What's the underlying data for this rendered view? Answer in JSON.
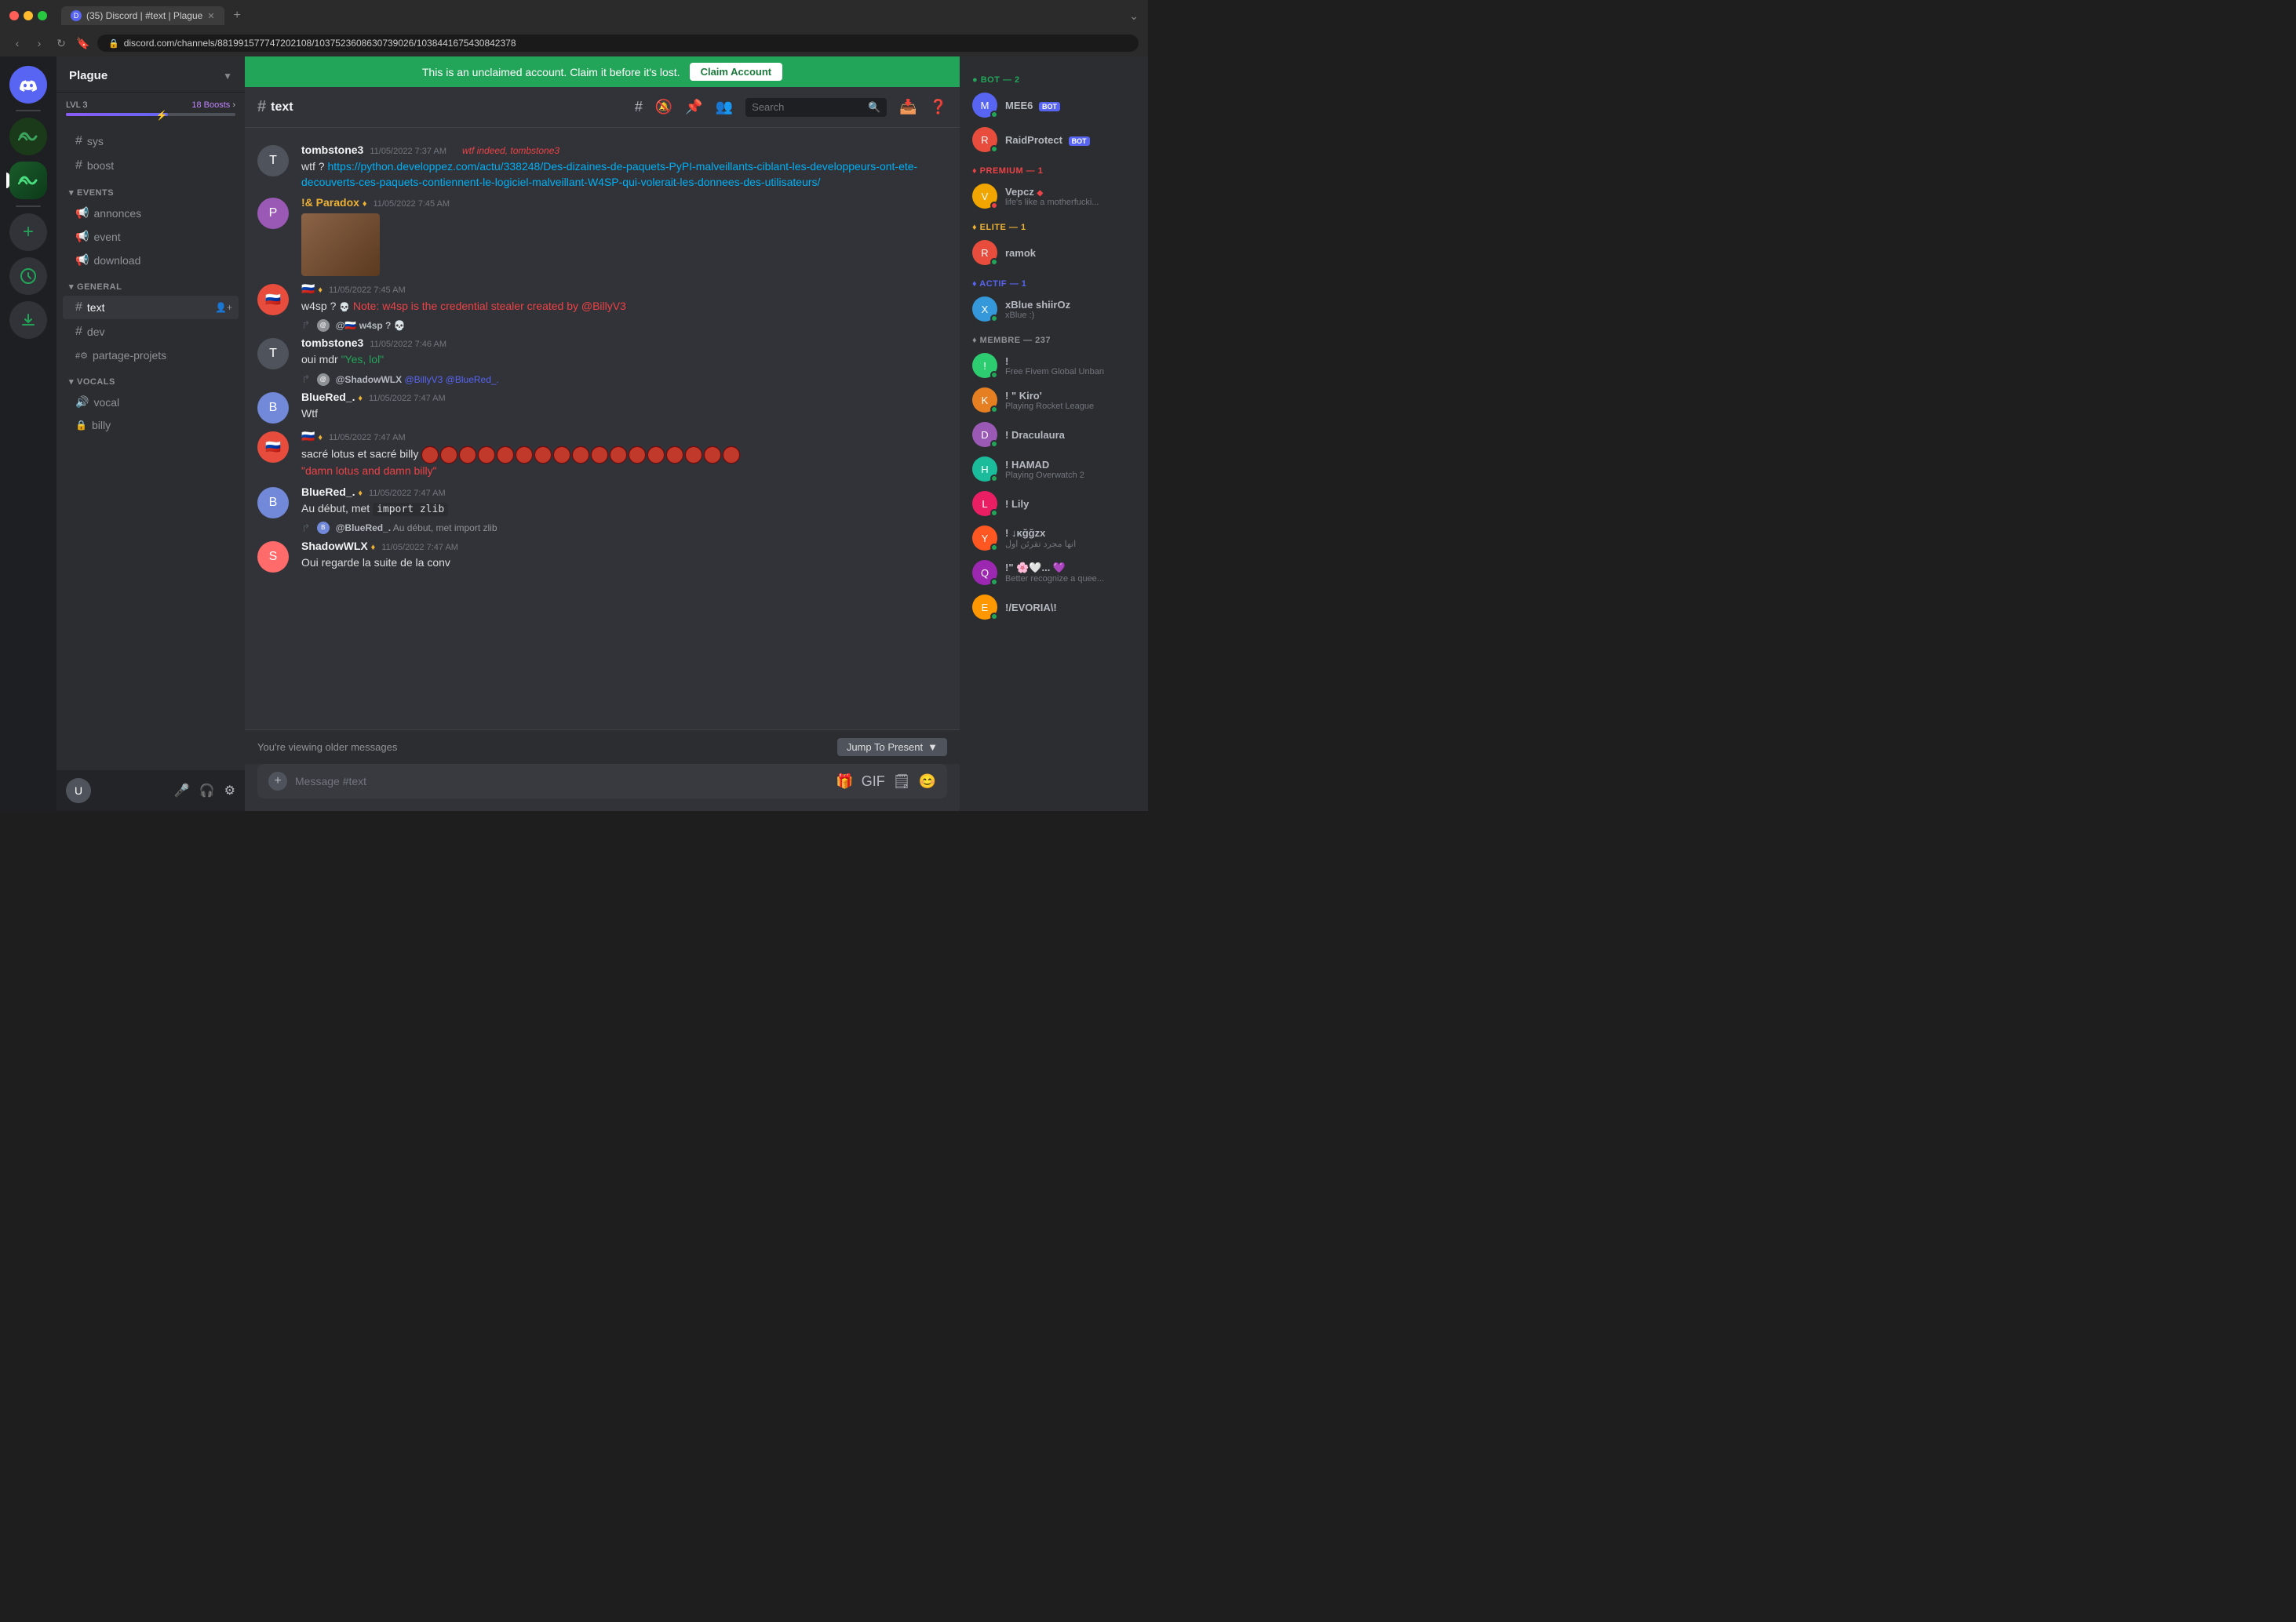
{
  "browser": {
    "tab_count": "35",
    "tab_title": "(35) Discord | #text | Plague",
    "url": "discord.com/channels/881991577747202108/1037523608630739026/1038441675430842378"
  },
  "notification": {
    "text": "This is an unclaimed account. Claim it before it's lost.",
    "button_label": "Claim Account"
  },
  "server": {
    "name": "Plague",
    "boost_level": "LVL 3",
    "boosts": "18 Boosts"
  },
  "channel": {
    "name": "text",
    "category_events": "EVENTS",
    "channel_annonces": "annonces",
    "channel_event": "event",
    "channel_download": "download",
    "category_general": "GENERAL",
    "channel_text": "text",
    "channel_dev": "dev",
    "channel_partage": "partage-projets",
    "category_vocals": "VOCALS",
    "channel_vocal": "vocal",
    "channel_billy": "billy",
    "channel_sys": "sys",
    "channel_boost": "boost"
  },
  "header": {
    "channel_name": "text",
    "search_placeholder": "Search"
  },
  "messages": [
    {
      "id": "msg1",
      "username": "tombstone3",
      "timestamp": "11/05/2022 7:37 AM",
      "color": "default",
      "bot_tag": "",
      "reply_to": null,
      "text": "wtf ?",
      "link": "https://python.developpez.com/actu/338248/Des-dizaines-de-paquets-PyPI-malveillants-ciblant-les-developpeurs-ont-ete-decouverts-ces-paquets-contiennent-le-logiciel-malveillant-W4SP-qui-volerait-les-donnees-des-utilisateurs/",
      "link_text": "https://python.developpez.com/actu/338248/Des-dizaines-de-paquets-PyPI-malveillants-ciblant-les-developpeurs-ont-ete-decouverts-ces-paquets-contiennent-le-logiciel-malveillant-W4SP-qui-volerait-les-donnees-des-utilisateurs/",
      "extra": "wtf indeed, tombstone3",
      "extra_color": "red",
      "has_image": false
    },
    {
      "id": "msg2",
      "username": "!& Paradox",
      "timestamp": "11/05/2022 7:45 AM",
      "color": "default",
      "bot_tag": "",
      "reply_to": null,
      "text": "",
      "has_image": true
    },
    {
      "id": "msg3",
      "username": "",
      "timestamp": "11/05/2022 7:45 AM",
      "color": "default",
      "bot_tag": "",
      "reply_to": null,
      "text": "w4sp ?",
      "note": "Note: w4sp is the credential stealer created by @BillyV3",
      "note_color": "red",
      "has_image": false
    },
    {
      "id": "msg4",
      "username": "tombstone3",
      "timestamp": "11/05/2022 7:46 AM",
      "color": "default",
      "reply_to": "@w4sp ?",
      "text": "oui mdr",
      "quoted": "\"Yes, lol\"",
      "quoted_color": "green",
      "has_image": false
    },
    {
      "id": "msg5",
      "username": "BlueRed_.",
      "timestamp": "11/05/2022 7:47 AM",
      "color": "default",
      "bot_tag": "",
      "reply_to": "@ShadowWLX @BillyV3 @BlueRed_.",
      "text": "Wtf",
      "has_image": false
    },
    {
      "id": "msg6",
      "username": "",
      "timestamp": "11/05/2022 7:47 AM",
      "color": "default",
      "reply_to": null,
      "text": "sacré lotus et sacré billy",
      "quoted": "\"damn lotus and damn billy\"",
      "quoted_color": "red",
      "has_emojis": true
    },
    {
      "id": "msg7",
      "username": "BlueRed_.",
      "timestamp": "11/05/2022 7:47 AM",
      "color": "default",
      "reply_to": null,
      "text": "Au début, met import zlib",
      "has_code": true,
      "code": "import zlib"
    },
    {
      "id": "msg8",
      "username": "ShadowWLX",
      "timestamp": "11/05/2022 7:47 AM",
      "color": "default",
      "reply_to": "@BlueRed_. Au début, met import zlib",
      "text": "Oui regarde la suite de la conv",
      "has_image": false
    }
  ],
  "input": {
    "placeholder": "Message #text"
  },
  "older_messages": {
    "text": "You're viewing older messages",
    "button_label": "Jump To Present"
  },
  "members": {
    "categories": [
      {
        "name": "BOT — 2",
        "color": "#23a559",
        "members": [
          {
            "name": "MEE6",
            "bot": true,
            "status": "online",
            "color": "mee6",
            "status_color": "online"
          },
          {
            "name": "RaidProtect",
            "bot": true,
            "status": "online",
            "color": "raidprotect",
            "status_color": "online"
          }
        ]
      },
      {
        "name": "PREMIUM — 1",
        "color": "#ed4245",
        "members": [
          {
            "name": "Vepcz",
            "status": "dnd",
            "color": "vepcz",
            "status_text": "life's like a motherfucki...",
            "status_color": "dnd"
          }
        ]
      },
      {
        "name": "ELITE — 1",
        "color": "#f0b232",
        "members": [
          {
            "name": "ramok",
            "status": "online",
            "color": "ramok",
            "status_color": "online"
          }
        ]
      },
      {
        "name": "ACTIF — 1",
        "color": "#5865f2",
        "members": [
          {
            "name": "xBlue shiirOz",
            "status": "online",
            "color": "xblue",
            "status_text": "xBlue :)",
            "status_color": "online"
          }
        ]
      },
      {
        "name": "MEMBRE — 237",
        "color": "#8e9297",
        "members": [
          {
            "name": "!",
            "status": "online",
            "color": "exclaim",
            "status_text": "Free Fivem Global Unban",
            "status_color": "online"
          },
          {
            "name": "! \" Kiro'",
            "status": "online",
            "color": "kiro",
            "status_text": "Playing Rocket League",
            "status_color": "online"
          },
          {
            "name": "! Draculaura",
            "status": "online",
            "color": "dracula",
            "status_color": "online"
          },
          {
            "name": "! HAMAD",
            "status": "online",
            "color": "hamad",
            "status_text": "Playing Overwatch 2",
            "status_color": "online"
          },
          {
            "name": "! Lily",
            "status": "online",
            "color": "lily",
            "status_color": "online"
          },
          {
            "name": "! ↓κğğzx",
            "status": "online",
            "color": "ykggzx",
            "status_text": "انها مجرد تقرئن اول",
            "status_color": "online"
          },
          {
            "name": "!\" 🌸🤍... 💜",
            "status": "online",
            "color": "quote",
            "status_text": "Better recognize a quee...",
            "status_color": "online"
          },
          {
            "name": "!/EVORIA\\!",
            "status": "online",
            "color": "evoria",
            "status_color": "online"
          }
        ]
      }
    ]
  }
}
